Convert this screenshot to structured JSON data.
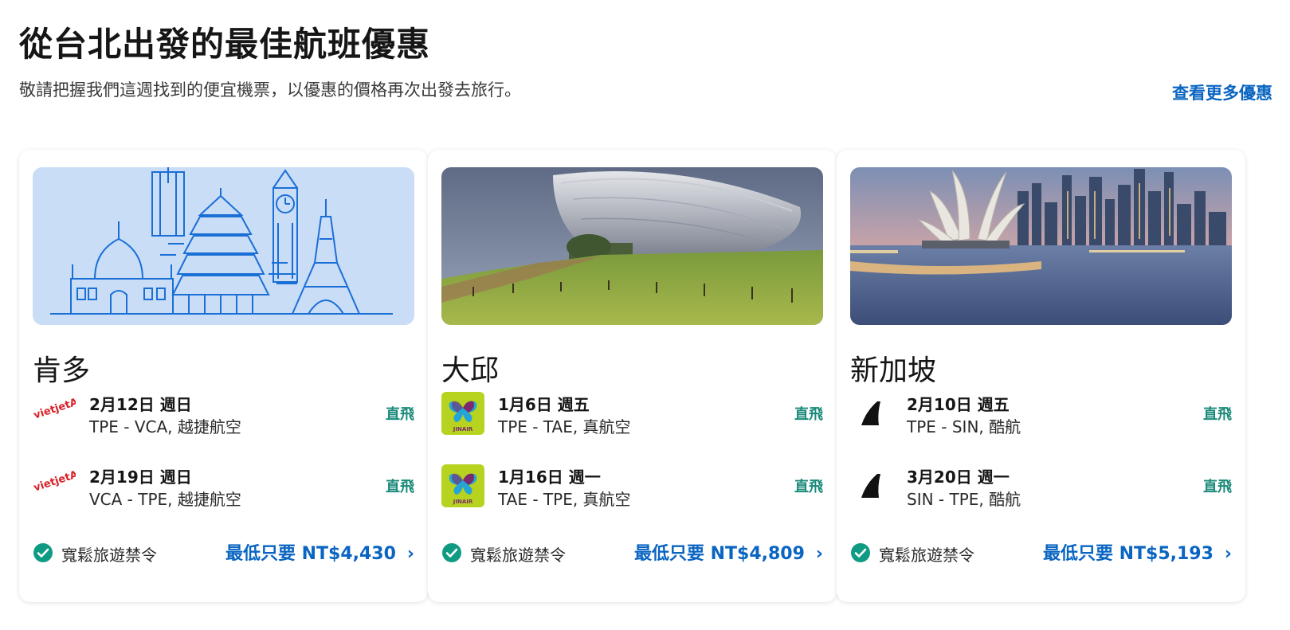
{
  "header": {
    "title": "從台北出發的最佳航班優惠",
    "subtitle": "敬請把握我們這週找到的便宜機票，以優惠的價格再次出發去旅行。",
    "more_link": "查看更多優惠"
  },
  "colors": {
    "accent": "#0a65c2",
    "direct": "#1b8a7a",
    "check": "#0f9b83"
  },
  "cards": [
    {
      "city": "肯多",
      "image": "landmarks-illustration",
      "flights": [
        {
          "date": "2月12日 週日",
          "route": "TPE - VCA, 越捷航空",
          "direct": "直飛",
          "airline_logo": "vietjet-logo",
          "logo_text": "vietjetAir.com"
        },
        {
          "date": "2月19日 週日",
          "route": "VCA - TPE, 越捷航空",
          "direct": "直飛",
          "airline_logo": "vietjet-logo",
          "logo_text": "vietjetAir.com"
        }
      ],
      "policy": "寬鬆旅遊禁令",
      "price": "最低只要 NT$4,430"
    },
    {
      "city": "大邱",
      "image": "daegu-stadium-photo",
      "flights": [
        {
          "date": "1月6日 週五",
          "route": "TPE - TAE, 真航空",
          "direct": "直飛",
          "airline_logo": "jinair-logo",
          "logo_text": "JINAIR"
        },
        {
          "date": "1月16日 週一",
          "route": "TAE - TPE, 真航空",
          "direct": "直飛",
          "airline_logo": "jinair-logo",
          "logo_text": "JINAIR"
        }
      ],
      "policy": "寬鬆旅遊禁令",
      "price": "最低只要 NT$4,809"
    },
    {
      "city": "新加坡",
      "image": "singapore-skyline-photo",
      "flights": [
        {
          "date": "2月10日 週五",
          "route": "TPE - SIN, 酷航",
          "direct": "直飛",
          "airline_logo": "scoot-logo"
        },
        {
          "date": "3月20日 週一",
          "route": "SIN - TPE, 酷航",
          "direct": "直飛",
          "airline_logo": "scoot-logo"
        }
      ],
      "policy": "寬鬆旅遊禁令",
      "price": "最低只要 NT$5,193"
    }
  ]
}
